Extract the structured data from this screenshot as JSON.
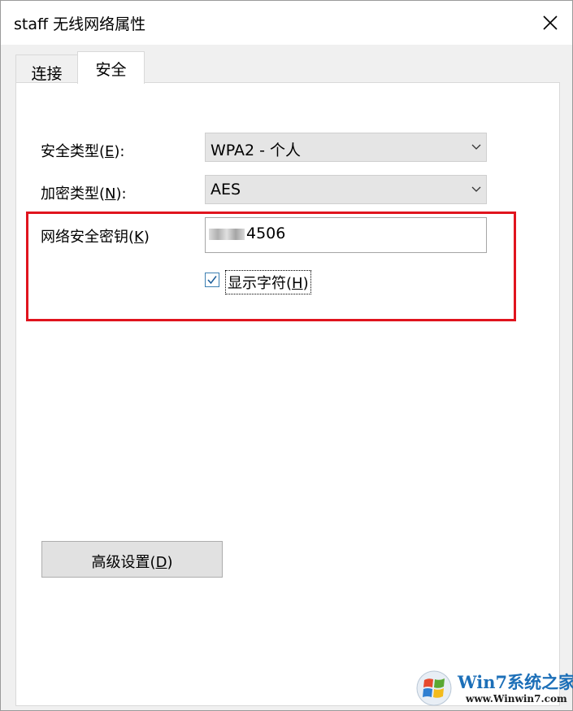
{
  "window": {
    "title": "staff 无线网络属性"
  },
  "tabs": [
    {
      "label": "连接",
      "active": false
    },
    {
      "label": "安全",
      "active": true
    }
  ],
  "security": {
    "security_type": {
      "label_pre": "安全类型(",
      "label_key": "E",
      "label_post": "):",
      "value": "WPA2 - 个人"
    },
    "encryption_type": {
      "label_pre": "加密类型(",
      "label_key": "N",
      "label_post": "):",
      "value": "AES"
    },
    "network_key": {
      "label_pre": "网络安全密钥(",
      "label_key": "K",
      "label_post": ")",
      "value_visible": "4506"
    },
    "show_chars": {
      "label_pre": "显示字符(",
      "label_key": "H",
      "label_post": ")",
      "checked": true
    }
  },
  "advanced_button": {
    "label_pre": "高级设置(",
    "label_key": "D",
    "label_post": ")"
  },
  "watermark": {
    "title": "Win7系统之家",
    "url": "www.Winwin7.com"
  },
  "colors": {
    "highlight": "#e0141e",
    "checkbox_border": "#3c7fb1",
    "watermark_blue": "#1c6fb8"
  },
  "icons": {
    "close": "close-icon",
    "dropdown": "chevron-down-icon",
    "check": "checkmark-icon"
  }
}
